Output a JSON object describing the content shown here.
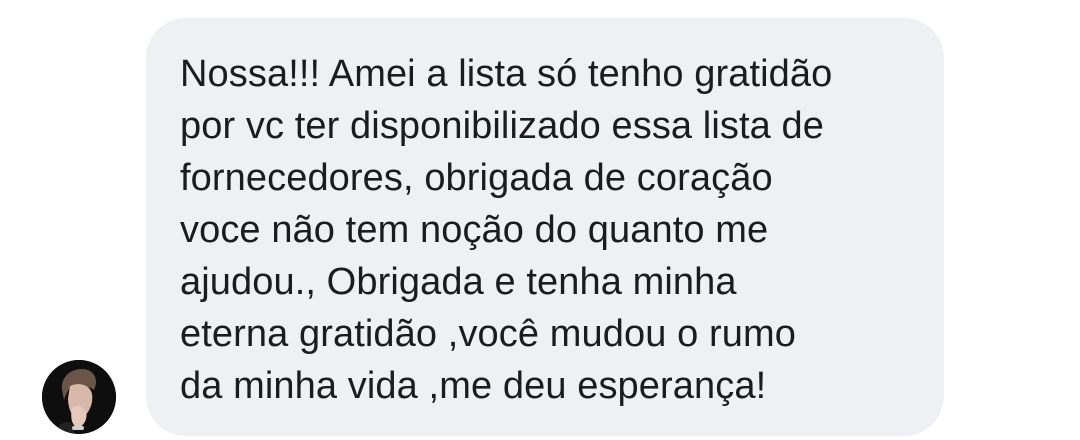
{
  "conversation": {
    "message": {
      "lines": [
        "Nossa!!! Amei a lista só tenho gratidão",
        "por vc ter disponibilizado essa lista de",
        "fornecedores, obrigada de coração",
        "voce não tem noção do quanto me",
        "ajudou., Obrigada e tenha minha",
        "eterna gratidão ,você mudou o rumo",
        "da minha vida ,me deu esperança!"
      ],
      "bubble_color": "#eff0f3",
      "text_color": "#1c1c1e"
    },
    "sender": {
      "avatar_icon": "profile-photo-icon"
    }
  }
}
